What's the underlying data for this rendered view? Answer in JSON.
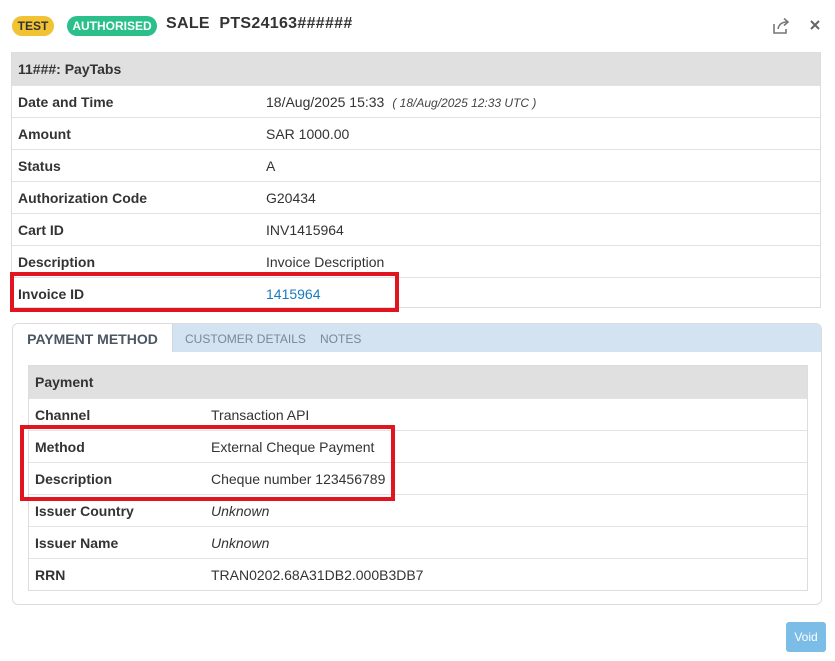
{
  "header": {
    "badge_test": "TEST",
    "badge_status": "AUTHORISED",
    "title": "SALE  PTS24163######",
    "share_icon": "share-icon",
    "close_icon": "close-icon"
  },
  "transaction": {
    "section_title": "11###: PayTabs",
    "rows": [
      {
        "label": "Date and Time",
        "value": "18/Aug/2025 15:33",
        "extra": "( 18/Aug/2025 12:33 UTC )"
      },
      {
        "label": "Amount",
        "value": "SAR 1000.00"
      },
      {
        "label": "Status",
        "value": "A"
      },
      {
        "label": "Authorization Code",
        "value": "G20434"
      },
      {
        "label": "Cart ID",
        "value": "INV1415964"
      },
      {
        "label": "Description",
        "value": "Invoice Description"
      },
      {
        "label": "Invoice ID",
        "value": "1415964"
      }
    ]
  },
  "tabs": [
    {
      "label": "PAYMENT METHOD",
      "active": true
    },
    {
      "label": "CUSTOMER DETAILS",
      "active": false
    },
    {
      "label": "NOTES",
      "active": false
    }
  ],
  "payment": {
    "section_title": "Payment",
    "rows": [
      {
        "label": "Channel",
        "value": "Transaction API"
      },
      {
        "label": "Method",
        "value": "External Cheque Payment"
      },
      {
        "label": "Description",
        "value": "Cheque number 123456789"
      },
      {
        "label": "Issuer Country",
        "value": "Unknown"
      },
      {
        "label": "Issuer Name",
        "value": "Unknown"
      },
      {
        "label": "RRN",
        "value": "TRAN0202.68A31DB2.000B3DB7"
      }
    ]
  },
  "actions": {
    "void_label": "Void"
  },
  "colors": {
    "highlight": "#e0151f",
    "test_badge": "#f1c232",
    "authorised_badge": "#2bbf8a",
    "link": "#1a7bbf",
    "void_button": "#7bbde6"
  }
}
